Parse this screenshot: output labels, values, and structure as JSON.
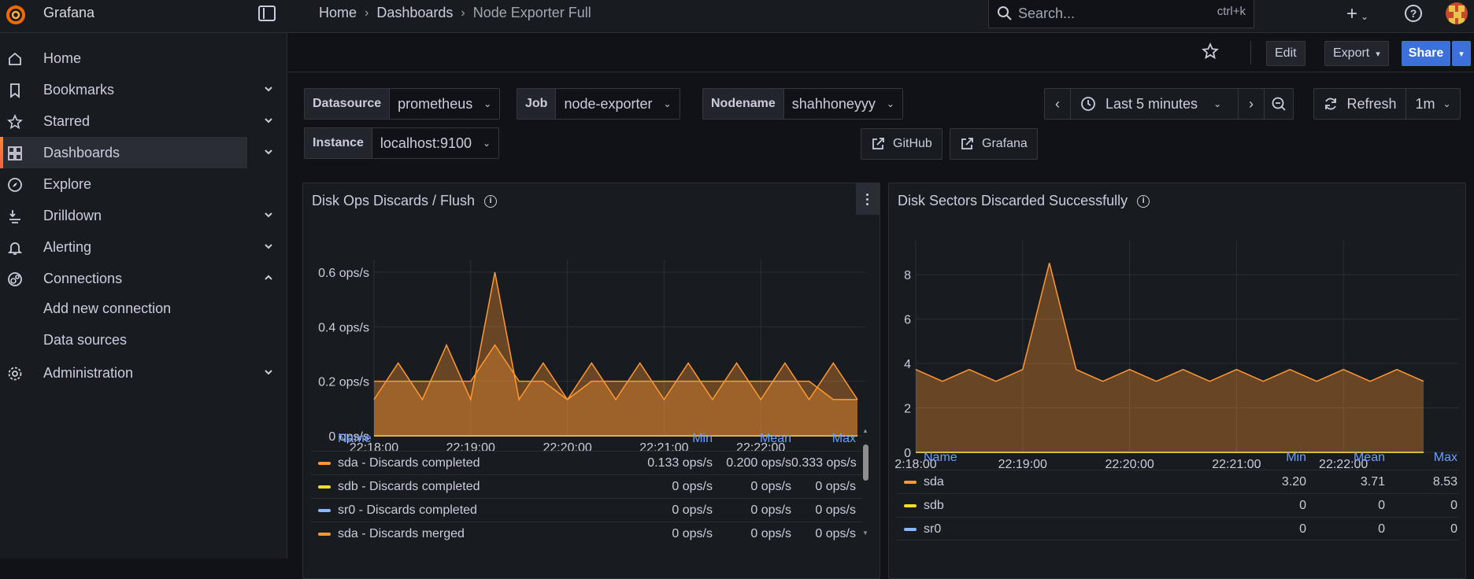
{
  "app": {
    "name": "Grafana"
  },
  "breadcrumb": {
    "home": "Home",
    "dashboards": "Dashboards",
    "current": "Node Exporter Full"
  },
  "search": {
    "placeholder": "Search...",
    "shortcut": "ctrl+k"
  },
  "sidebar": {
    "items": [
      {
        "label": "Home",
        "icon": "home-icon"
      },
      {
        "label": "Bookmarks",
        "icon": "bookmark-icon"
      },
      {
        "label": "Starred",
        "icon": "star-icon"
      },
      {
        "label": "Dashboards",
        "icon": "dashboards-icon"
      },
      {
        "label": "Explore",
        "icon": "compass-icon"
      },
      {
        "label": "Drilldown",
        "icon": "drilldown-icon"
      },
      {
        "label": "Alerting",
        "icon": "bell-icon"
      },
      {
        "label": "Connections",
        "icon": "connections-icon"
      },
      {
        "label": "Administration",
        "icon": "gear-icon"
      }
    ],
    "sub_items": [
      "Add new connection",
      "Data sources"
    ]
  },
  "toolbar": {
    "edit": "Edit",
    "export": "Export",
    "share": "Share"
  },
  "variables": {
    "datasource": {
      "label": "Datasource",
      "value": "prometheus"
    },
    "job": {
      "label": "Job",
      "value": "node-exporter"
    },
    "nodename": {
      "label": "Nodename",
      "value": "shahhoneyyy"
    },
    "instance": {
      "label": "Instance",
      "value": "localhost:9100"
    }
  },
  "time": {
    "range": "Last 5 minutes",
    "refresh": "Refresh",
    "interval": "1m"
  },
  "links": {
    "github": "GitHub",
    "grafana": "Grafana"
  },
  "colors": {
    "orange": "#ff9830",
    "yellow": "#fade2a",
    "blue": "#8ab8ff",
    "green": "#73bf69",
    "accent": "#3d71d9"
  },
  "panels": [
    {
      "title": "Disk Ops Discards / Flush",
      "legend": {
        "headers": [
          "Name",
          "Min",
          "Mean",
          "Max"
        ],
        "rows": [
          {
            "name": "sda - Discards completed",
            "color": "#ff9830",
            "min": "0.133 ops/s",
            "mean": "0.200 ops/s",
            "max": "0.333 ops/s"
          },
          {
            "name": "sdb - Discards completed",
            "color": "#fade2a",
            "min": "0 ops/s",
            "mean": "0 ops/s",
            "max": "0 ops/s"
          },
          {
            "name": "sr0 - Discards completed",
            "color": "#8ab8ff",
            "min": "0 ops/s",
            "mean": "0 ops/s",
            "max": "0 ops/s"
          },
          {
            "name": "sda - Discards merged",
            "color": "#ff9830",
            "min": "0 ops/s",
            "mean": "0 ops/s",
            "max": "0 ops/s"
          }
        ]
      }
    },
    {
      "title": "Disk Sectors Discarded Successfully",
      "legend": {
        "headers": [
          "Name",
          "Min",
          "Mean",
          "Max"
        ],
        "rows": [
          {
            "name": "sda",
            "color": "#ff9830",
            "min": "3.20",
            "mean": "3.71",
            "max": "8.53"
          },
          {
            "name": "sdb",
            "color": "#fade2a",
            "min": "0",
            "mean": "0",
            "max": "0"
          },
          {
            "name": "sr0",
            "color": "#8ab8ff",
            "min": "0",
            "mean": "0",
            "max": "0"
          }
        ]
      }
    }
  ],
  "chart_data": [
    {
      "type": "area",
      "title": "Disk Ops Discards / Flush",
      "ylim": [
        0,
        0.6
      ],
      "yticks": [
        "0 ops/s",
        "0.2 ops/s",
        "0.4 ops/s",
        "0.6 ops/s"
      ],
      "xticks": [
        "22:18:00",
        "22:19:00",
        "22:20:00",
        "22:21:00",
        "22:22:00"
      ],
      "x_seconds": [
        0,
        15,
        30,
        45,
        60,
        75,
        90,
        105,
        120,
        135,
        150,
        165,
        180,
        195,
        210,
        225,
        240,
        255,
        270,
        285,
        300
      ],
      "series": [
        {
          "name": "sda - Discards completed",
          "color": "#ff9830",
          "values": [
            0.133,
            0.267,
            0.133,
            0.333,
            0.133,
            0.6,
            0.133,
            0.267,
            0.133,
            0.267,
            0.133,
            0.267,
            0.133,
            0.267,
            0.133,
            0.267,
            0.133,
            0.267,
            0.133,
            0.267,
            0.133
          ]
        },
        {
          "name": "sda - Discards merged",
          "color": "#ff9830",
          "values": [
            0.2,
            0.2,
            0.2,
            0.2,
            0.2,
            0.333,
            0.2,
            0.2,
            0.133,
            0.2,
            0.2,
            0.2,
            0.2,
            0.2,
            0.2,
            0.2,
            0.2,
            0.2,
            0.2,
            0.133,
            0.133
          ]
        },
        {
          "name": "sdb - Discards completed",
          "color": "#fade2a",
          "values": [
            0,
            0,
            0,
            0,
            0,
            0,
            0,
            0,
            0,
            0,
            0,
            0,
            0,
            0,
            0,
            0,
            0,
            0,
            0,
            0,
            0
          ]
        },
        {
          "name": "sr0 - Discards completed",
          "color": "#8ab8ff",
          "values": [
            0,
            0,
            0,
            0,
            0,
            0,
            0,
            0,
            0,
            0,
            0,
            0,
            0,
            0,
            0,
            0,
            0,
            0,
            0,
            0,
            0
          ]
        }
      ]
    },
    {
      "type": "area",
      "title": "Disk Sectors Discarded Successfully",
      "ylim": [
        0,
        9
      ],
      "yticks": [
        "0",
        "2",
        "4",
        "6",
        "8"
      ],
      "xticks": [
        "2:18:00",
        "22:19:00",
        "22:20:00",
        "22:21:00",
        "22:22:00"
      ],
      "x_seconds": [
        0,
        15,
        30,
        45,
        60,
        75,
        90,
        105,
        120,
        135,
        150,
        165,
        180,
        195,
        210,
        225,
        240,
        255,
        270,
        285
      ],
      "series": [
        {
          "name": "sda",
          "color": "#ff9830",
          "values": [
            3.73,
            3.2,
            3.73,
            3.2,
            3.73,
            8.53,
            3.73,
            3.2,
            3.73,
            3.2,
            3.73,
            3.2,
            3.73,
            3.2,
            3.73,
            3.2,
            3.73,
            3.2,
            3.73,
            3.2
          ]
        },
        {
          "name": "sdb",
          "color": "#fade2a",
          "values": [
            0,
            0,
            0,
            0,
            0,
            0,
            0,
            0,
            0,
            0,
            0,
            0,
            0,
            0,
            0,
            0,
            0,
            0,
            0,
            0
          ]
        },
        {
          "name": "sr0",
          "color": "#8ab8ff",
          "values": [
            0,
            0,
            0,
            0,
            0,
            0,
            0,
            0,
            0,
            0,
            0,
            0,
            0,
            0,
            0,
            0,
            0,
            0,
            0,
            0
          ]
        }
      ]
    }
  ]
}
